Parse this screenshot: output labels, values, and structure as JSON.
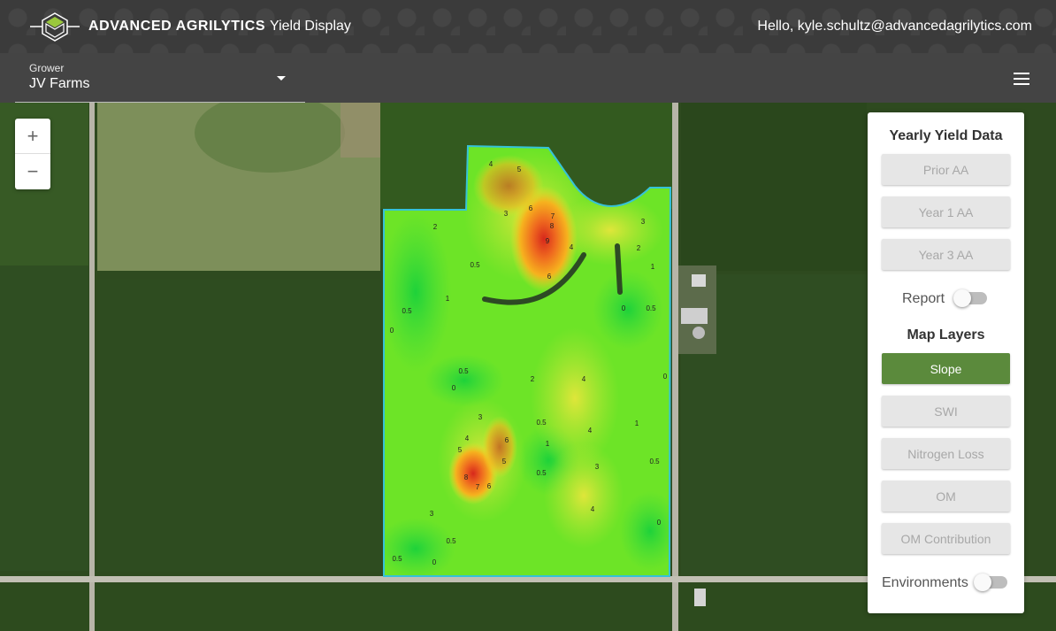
{
  "header": {
    "brand": "ADVANCED AGRILYTICS",
    "page_title": "Yield Display",
    "greeting": "Hello, kyle.schultz@advancedagrilytics.com"
  },
  "grower": {
    "label": "Grower",
    "value": "JV Farms"
  },
  "panel": {
    "yearly_heading": "Yearly Yield Data",
    "yearly_buttons": [
      "Prior AA",
      "Year 1 AA",
      "Year 3 AA"
    ],
    "report_label": "Report",
    "report_on": false,
    "layers_heading": "Map Layers",
    "layer_buttons": [
      "Slope",
      "SWI",
      "Nitrogen Loss",
      "OM",
      "OM Contribution"
    ],
    "active_layer": "Slope",
    "environments_label": "Environments",
    "environments_on": false
  },
  "map": {
    "zoom_in": "+",
    "zoom_out": "−",
    "contour_labels": [
      "4",
      "5",
      "3",
      "6",
      "7",
      "8",
      "9",
      "4",
      "6",
      "2",
      "0.5",
      "1",
      "0.5",
      "0",
      "0",
      "0.5",
      "3",
      "2",
      "1",
      "0.5",
      "0",
      "2",
      "4",
      "0",
      "3",
      "4",
      "6",
      "5",
      "5",
      "8",
      "7",
      "6",
      "0.5",
      "1",
      "0.5",
      "4",
      "3",
      "1",
      "0.5",
      "3",
      "4",
      "0.5",
      "0.5",
      "0",
      "0"
    ]
  },
  "colors": {
    "header_bg": "#3b3b3b",
    "subbar_bg": "#444444",
    "active_layer": "#5b8a3c",
    "field_outline": "#35c2d8"
  }
}
